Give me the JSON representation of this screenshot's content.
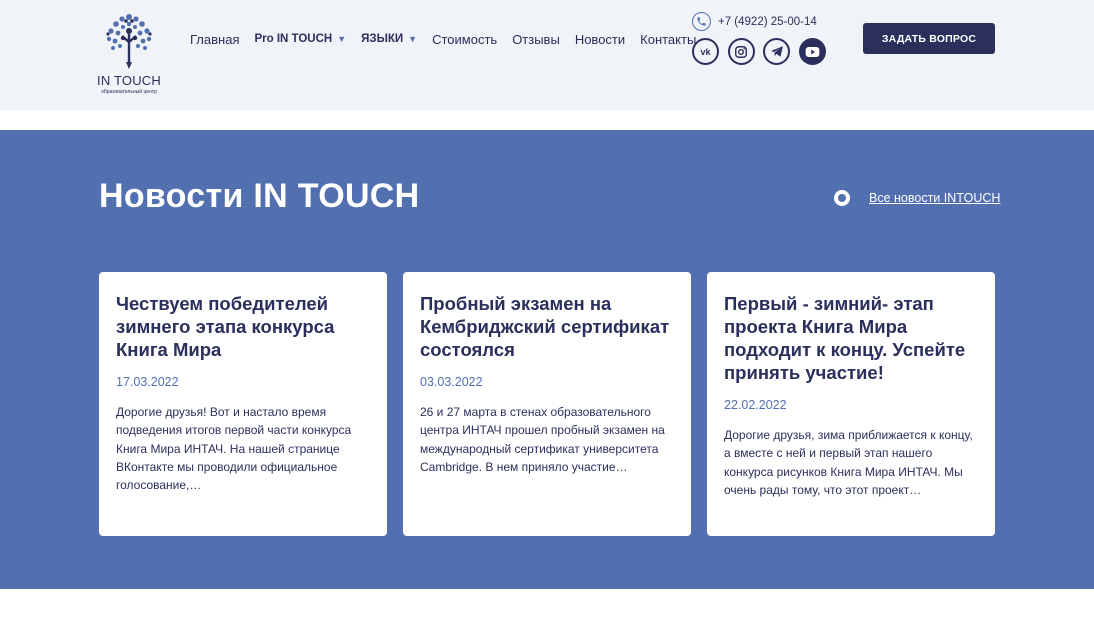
{
  "logo": {
    "title": "IN TOUCH",
    "subtitle": "образовательный центр"
  },
  "nav": {
    "items": [
      {
        "label": "Главная"
      },
      {
        "label": "Pro IN TOUCH"
      },
      {
        "label": "ЯЗЫКИ"
      },
      {
        "label": "Стоимость"
      },
      {
        "label": "Отзывы"
      },
      {
        "label": "Новости"
      },
      {
        "label": "Контакты"
      }
    ]
  },
  "contact": {
    "phone": "+7 (4922) 25-00-14",
    "socials": [
      {
        "icon": "vk-icon",
        "label": "vk"
      },
      {
        "icon": "instagram-icon"
      },
      {
        "icon": "telegram-icon"
      },
      {
        "icon": "youtube-icon"
      }
    ]
  },
  "cta": {
    "label": "ЗАДАТЬ ВОПРОС"
  },
  "news": {
    "title": "Новости IN TOUCH",
    "all_link": "Все новости INTOUCH",
    "cards": [
      {
        "title": "Чествуем победителей зимнего этапа конкурса Книга Мира",
        "date": "17.03.2022",
        "text": "Дорогие друзья! Вот и настало время подведения итогов первой части конкурса Книга Мира ИНТАЧ.  На нашей странице ВКонтакте мы проводили официальное голосование,…"
      },
      {
        "title": "Пробный экзамен на Кембриджский сертификат состоялся",
        "date": "03.03.2022",
        "text": "26 и 27 марта в стенах образовательного центра  ИНТАЧ прошел пробный экзамен на международный сертификат университета Cambridge. В нем приняло участие…"
      },
      {
        "title": "Первый - зимний- этап проекта Книга Мира подходит к концу. Успейте принять участие!",
        "date": "22.02.2022",
        "text": "Дорогие друзья, зима приближается к концу, а вместе с ней и первый этап нашего конкурса рисунков Книга Мира ИНТАЧ. Мы очень рады тому, что этот проект…"
      }
    ]
  },
  "colors": {
    "navy": "#2b2f5c",
    "blue": "#526fb0",
    "header_bg": "#f0f3f8"
  }
}
